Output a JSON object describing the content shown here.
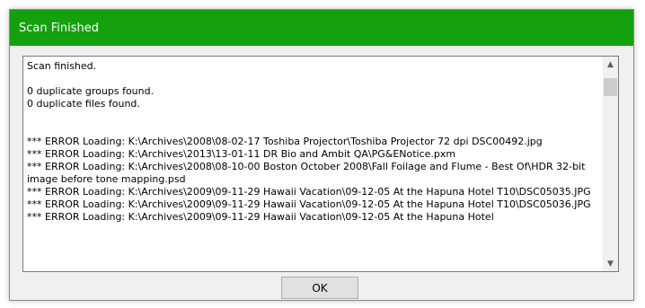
{
  "window": {
    "title": "Scan Finished",
    "accent_color": "#13a10e"
  },
  "log": {
    "lines": [
      {
        "text": "Scan finished."
      },
      {
        "text": ""
      },
      {
        "text": "0 duplicate groups found."
      },
      {
        "text": "0 duplicate files found."
      },
      {
        "text": ""
      },
      {
        "text": ""
      },
      {
        "text": "*** ERROR Loading: K:\\Archives\\2008\\08-02-17 Toshiba Projector\\Toshiba Projector 72 dpi DSC00492.jpg"
      },
      {
        "text": "*** ERROR Loading: K:\\Archives\\2013\\13-01-11 DR Bio and Ambit QA\\PG&ENotice.pxm"
      },
      {
        "text": "*** ERROR Loading: K:\\Archives\\2008\\08-10-00 Boston October 2008\\Fall Foilage and Flume - Best Of\\HDR 32-bit image before tone mapping.psd"
      },
      {
        "text": "*** ERROR Loading: K:\\Archives\\2009\\09-11-29 Hawaii Vacation\\09-12-05 At the Hapuna Hotel T10\\DSC05035.JPG"
      },
      {
        "text": "*** ERROR Loading: K:\\Archives\\2009\\09-11-29 Hawaii Vacation\\09-12-05 At the Hapuna Hotel T10\\DSC05036.JPG"
      },
      {
        "text": "*** ERROR Loading: K:\\Archives\\2009\\09-11-29 Hawaii Vacation\\09-12-05 At the Hapuna Hotel"
      }
    ]
  },
  "scrollbar": {
    "up_icon": "chevron-up-icon",
    "down_icon": "chevron-down-icon"
  },
  "buttons": {
    "ok_label": "OK"
  }
}
